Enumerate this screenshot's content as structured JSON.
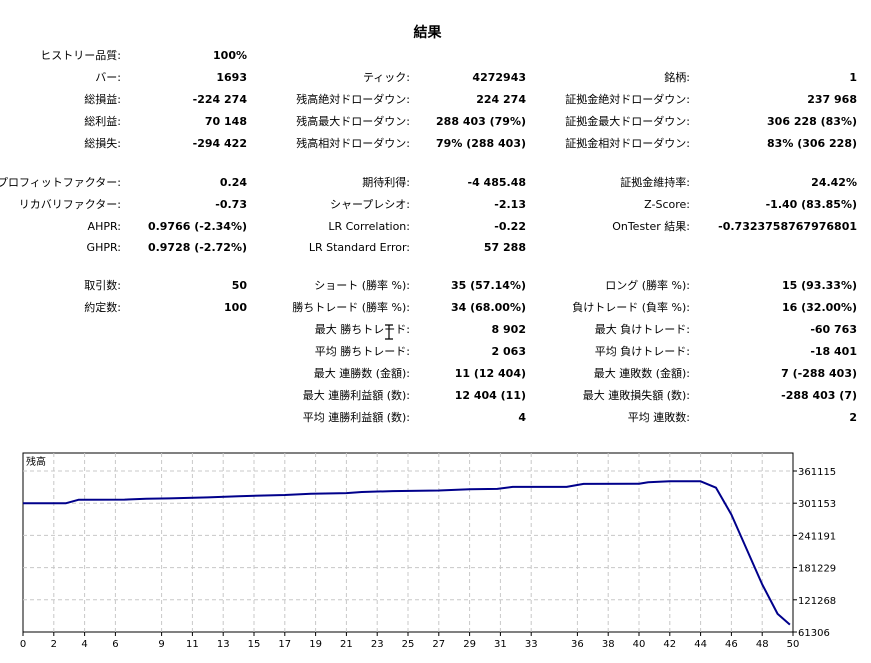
{
  "title": "結果",
  "rows": [
    [
      {
        "label": "ヒストリー品質:",
        "value": "100%"
      },
      null,
      null
    ],
    [
      {
        "label": "バー:",
        "value": "1693"
      },
      {
        "label": "ティック:",
        "value": "4272943"
      },
      {
        "label": "銘柄:",
        "value": "1"
      }
    ],
    [
      {
        "label": "総損益:",
        "value": "-224 274"
      },
      {
        "label": "残高絶対ドローダウン:",
        "value": "224 274"
      },
      {
        "label": "証拠金絶対ドローダウン:",
        "value": "237 968"
      }
    ],
    [
      {
        "label": "総利益:",
        "value": "70 148"
      },
      {
        "label": "残高最大ドローダウン:",
        "value": "288 403 (79%)"
      },
      {
        "label": "証拠金最大ドローダウン:",
        "value": "306 228 (83%)"
      }
    ],
    [
      {
        "label": "総損失:",
        "value": "-294 422"
      },
      {
        "label": "残高相対ドローダウン:",
        "value": "79% (288 403)"
      },
      {
        "label": "証拠金相対ドローダウン:",
        "value": "83% (306 228)"
      }
    ],
    [
      {
        "label": "プロフィットファクター:",
        "value": "0.24"
      },
      {
        "label": "期待利得:",
        "value": "-4 485.48"
      },
      {
        "label": "証拠金維持率:",
        "value": "24.42%"
      }
    ],
    [
      {
        "label": "リカバリファクター:",
        "value": "-0.73"
      },
      {
        "label": "シャープレシオ:",
        "value": "-2.13"
      },
      {
        "label": "Z-Score:",
        "value": "-1.40 (83.85%)"
      }
    ],
    [
      {
        "label": "AHPR:",
        "value": "0.9766 (-2.34%)"
      },
      {
        "label": "LR Correlation:",
        "value": "-0.22"
      },
      {
        "label": "OnTester 結果:",
        "value": "-0.7323758767976801"
      }
    ],
    [
      {
        "label": "GHPR:",
        "value": "0.9728 (-2.72%)"
      },
      {
        "label": "LR Standard Error:",
        "value": "57 288"
      },
      null
    ],
    [
      {
        "label": "取引数:",
        "value": "50"
      },
      {
        "label": "ショート (勝率 %):",
        "value": "35 (57.14%)"
      },
      {
        "label": "ロング (勝率 %):",
        "value": "15 (93.33%)"
      }
    ],
    [
      {
        "label": "約定数:",
        "value": "100"
      },
      {
        "label": "勝ちトレード (勝率 %):",
        "value": "34 (68.00%)"
      },
      {
        "label": "負けトレード (負率 %):",
        "value": "16 (32.00%)"
      }
    ],
    [
      null,
      {
        "label": "最大 勝ちトレード:",
        "value": "8 902"
      },
      {
        "label": "最大 負けトレード:",
        "value": "-60 763"
      }
    ],
    [
      null,
      {
        "label": "平均 勝ちトレード:",
        "value": "2 063"
      },
      {
        "label": "平均 負けトレード:",
        "value": "-18 401"
      }
    ],
    [
      null,
      {
        "label": "最大 連勝数 (金額):",
        "value": "11 (12 404)"
      },
      {
        "label": "最大 連敗数 (金額):",
        "value": "7 (-288 403)"
      }
    ],
    [
      null,
      {
        "label": "最大 連勝利益額 (数):",
        "value": "12 404 (11)"
      },
      {
        "label": "最大 連敗損失額 (数):",
        "value": "-288 403 (7)"
      }
    ],
    [
      null,
      {
        "label": "平均 連勝利益額 (数):",
        "value": "4"
      },
      {
        "label": "平均 連敗数:",
        "value": "2"
      }
    ]
  ],
  "chart_data": {
    "type": "line",
    "title": "残高",
    "xlabel": "",
    "ylabel": "",
    "x_ticks": [
      0,
      2,
      4,
      6,
      9,
      11,
      13,
      15,
      17,
      19,
      21,
      23,
      25,
      27,
      29,
      31,
      33,
      36,
      38,
      40,
      42,
      44,
      46,
      48,
      50
    ],
    "y_ticks": [
      361115,
      301153,
      241191,
      181229,
      121268,
      61306
    ],
    "ylim": [
      61306,
      361115
    ],
    "xlim": [
      0,
      50
    ],
    "grid": true,
    "line_color": "#00008b",
    "series": [
      {
        "x": [
          0,
          2.8,
          3.6,
          6.6,
          8,
          9.5,
          12,
          14,
          17,
          18.7,
          21,
          22,
          24,
          27,
          29,
          30.8,
          31.8,
          35.3,
          36.4,
          40,
          40.6,
          42,
          44,
          45,
          46,
          47,
          48,
          49,
          49.8
        ],
        "values": [
          301153,
          301153,
          307400,
          307800,
          309300,
          310000,
          312000,
          314200,
          316400,
          318800,
          320000,
          322000,
          323700,
          324800,
          327200,
          327800,
          331500,
          331500,
          337000,
          337500,
          340000,
          342000,
          342000,
          330000,
          280000,
          215000,
          150000,
          95000,
          75000
        ]
      }
    ]
  }
}
